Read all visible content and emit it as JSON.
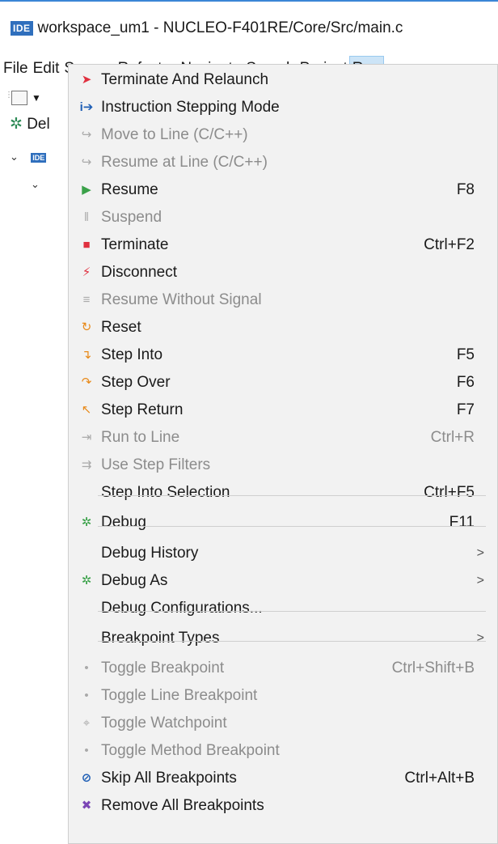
{
  "title_bar": {
    "badge": "IDE",
    "text": "workspace_um1 - NUCLEO-F401RE/Core/Src/main.c"
  },
  "menu_bar": [
    "File",
    "Edit",
    "Source",
    "Refactor",
    "Navigate",
    "Search",
    "Project",
    "Run"
  ],
  "left_panel": {
    "debug_tab_label": "Del",
    "tree_badge": "IDE"
  },
  "run_menu": [
    {
      "icon": "terminate-relaunch-icon",
      "label": "Terminate And Relaunch",
      "shortcut": "",
      "enabled": true
    },
    {
      "icon": "instruction-stepping-icon",
      "label": "Instruction Stepping Mode",
      "shortcut": "",
      "enabled": true
    },
    {
      "icon": "move-to-line-icon",
      "label": "Move to Line (C/C++)",
      "shortcut": "",
      "enabled": false
    },
    {
      "icon": "resume-at-line-icon",
      "label": "Resume at Line (C/C++)",
      "shortcut": "",
      "enabled": false
    },
    {
      "icon": "resume-icon",
      "label": "Resume",
      "shortcut": "F8",
      "enabled": true
    },
    {
      "icon": "suspend-icon",
      "label": "Suspend",
      "shortcut": "",
      "enabled": false
    },
    {
      "icon": "terminate-icon",
      "label": "Terminate",
      "shortcut": "Ctrl+F2",
      "enabled": true
    },
    {
      "icon": "disconnect-icon",
      "label": "Disconnect",
      "shortcut": "",
      "enabled": true
    },
    {
      "icon": "resume-without-signal-icon",
      "label": "Resume Without Signal",
      "shortcut": "",
      "enabled": false
    },
    {
      "icon": "reset-icon",
      "label": "Reset",
      "shortcut": "",
      "enabled": true
    },
    {
      "icon": "step-into-icon",
      "label": "Step Into",
      "shortcut": "F5",
      "enabled": true
    },
    {
      "icon": "step-over-icon",
      "label": "Step Over",
      "shortcut": "F6",
      "enabled": true
    },
    {
      "icon": "step-return-icon",
      "label": "Step Return",
      "shortcut": "F7",
      "enabled": true
    },
    {
      "icon": "run-to-line-icon",
      "label": "Run to Line",
      "shortcut": "Ctrl+R",
      "enabled": false
    },
    {
      "icon": "use-step-filters-icon",
      "label": "Use Step Filters",
      "shortcut": "",
      "enabled": false
    },
    {
      "icon": "",
      "label": "Step Into Selection",
      "shortcut": "Ctrl+F5",
      "enabled": true
    },
    {
      "icon": "debug-icon",
      "label": "Debug",
      "shortcut": "F11",
      "enabled": true
    },
    {
      "icon": "",
      "label": "Debug History",
      "shortcut": "",
      "enabled": true,
      "submenu": true
    },
    {
      "icon": "debug-as-icon",
      "label": "Debug As",
      "shortcut": "",
      "enabled": true,
      "submenu": true
    },
    {
      "icon": "",
      "label": "Debug Configurations...",
      "shortcut": "",
      "enabled": true
    },
    {
      "icon": "",
      "label": "Breakpoint Types",
      "shortcut": "",
      "enabled": true,
      "submenu": true
    },
    {
      "icon": "toggle-breakpoint-icon",
      "label": "Toggle Breakpoint",
      "shortcut": "Ctrl+Shift+B",
      "enabled": false
    },
    {
      "icon": "toggle-line-breakpoint-icon",
      "label": "Toggle Line Breakpoint",
      "shortcut": "",
      "enabled": false
    },
    {
      "icon": "toggle-watchpoint-icon",
      "label": "Toggle Watchpoint",
      "shortcut": "",
      "enabled": false
    },
    {
      "icon": "toggle-method-breakpoint-icon",
      "label": "Toggle Method Breakpoint",
      "shortcut": "",
      "enabled": false
    },
    {
      "icon": "skip-all-breakpoints-icon",
      "label": "Skip All Breakpoints",
      "shortcut": "Ctrl+Alt+B",
      "enabled": true
    },
    {
      "icon": "remove-all-breakpoints-icon",
      "label": "Remove All Breakpoints",
      "shortcut": "",
      "enabled": true
    }
  ],
  "submenu_arrow": ">"
}
